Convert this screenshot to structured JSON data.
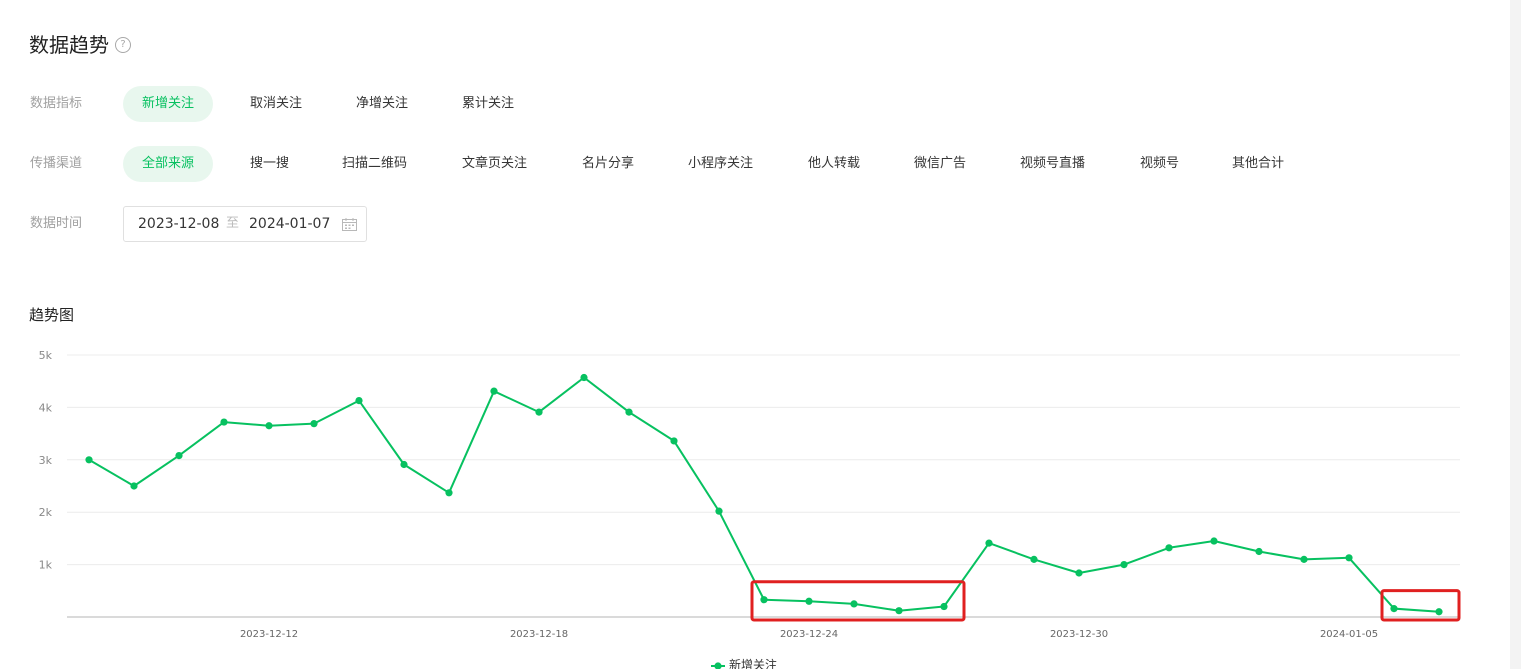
{
  "header": {
    "title": "数据趋势",
    "help_icon": "question-circle-icon"
  },
  "metrics": {
    "label": "数据指标",
    "options": [
      "新增关注",
      "取消关注",
      "净增关注",
      "累计关注"
    ],
    "selected": "新增关注"
  },
  "channels": {
    "label": "传播渠道",
    "options": [
      "全部来源",
      "搜一搜",
      "扫描二维码",
      "文章页关注",
      "名片分享",
      "小程序关注",
      "他人转载",
      "微信广告",
      "视频号直播",
      "视频号",
      "其他合计"
    ],
    "selected": "全部来源"
  },
  "date_range": {
    "label": "数据时间",
    "start": "2023-12-08",
    "separator": "至",
    "end": "2024-01-07",
    "icon": "calendar-icon"
  },
  "chart_section": {
    "title": "趋势图"
  },
  "colors": {
    "accent": "#07c160",
    "chip_bg": "#e8f7ee",
    "highlight_box": "#e02020"
  },
  "chart_data": {
    "type": "line",
    "title": "",
    "xlabel": "",
    "ylabel": "",
    "x": [
      "2023-12-08",
      "2023-12-09",
      "2023-12-10",
      "2023-12-11",
      "2023-12-12",
      "2023-12-13",
      "2023-12-14",
      "2023-12-15",
      "2023-12-16",
      "2023-12-17",
      "2023-12-18",
      "2023-12-19",
      "2023-12-20",
      "2023-12-21",
      "2023-12-22",
      "2023-12-23",
      "2023-12-24",
      "2023-12-25",
      "2023-12-26",
      "2023-12-27",
      "2023-12-28",
      "2023-12-29",
      "2023-12-30",
      "2023-12-31",
      "2024-01-01",
      "2024-01-02",
      "2024-01-03",
      "2024-01-04",
      "2024-01-05",
      "2024-01-06",
      "2024-01-07"
    ],
    "x_tick_labels": [
      "2023-12-12",
      "2023-12-18",
      "2023-12-24",
      "2023-12-30",
      "2024-01-05"
    ],
    "y_tick_labels": [
      "1k",
      "2k",
      "3k",
      "4k",
      "5k"
    ],
    "ylim": [
      0,
      5000
    ],
    "grid": true,
    "legend_position": "bottom-center",
    "series": [
      {
        "name": "新增关注",
        "color": "#07c160",
        "values": [
          3000,
          2500,
          3080,
          3720,
          3650,
          3690,
          4130,
          2910,
          2370,
          4310,
          3910,
          4570,
          3910,
          3360,
          2020,
          330,
          300,
          250,
          120,
          200,
          1410,
          1100,
          840,
          1000,
          1320,
          1450,
          1250,
          1100,
          1130,
          160,
          100
        ]
      }
    ],
    "highlight_boxes": [
      {
        "from": "2023-12-23",
        "to": "2023-12-27"
      },
      {
        "from": "2024-01-06",
        "to": "2024-01-07"
      }
    ]
  }
}
